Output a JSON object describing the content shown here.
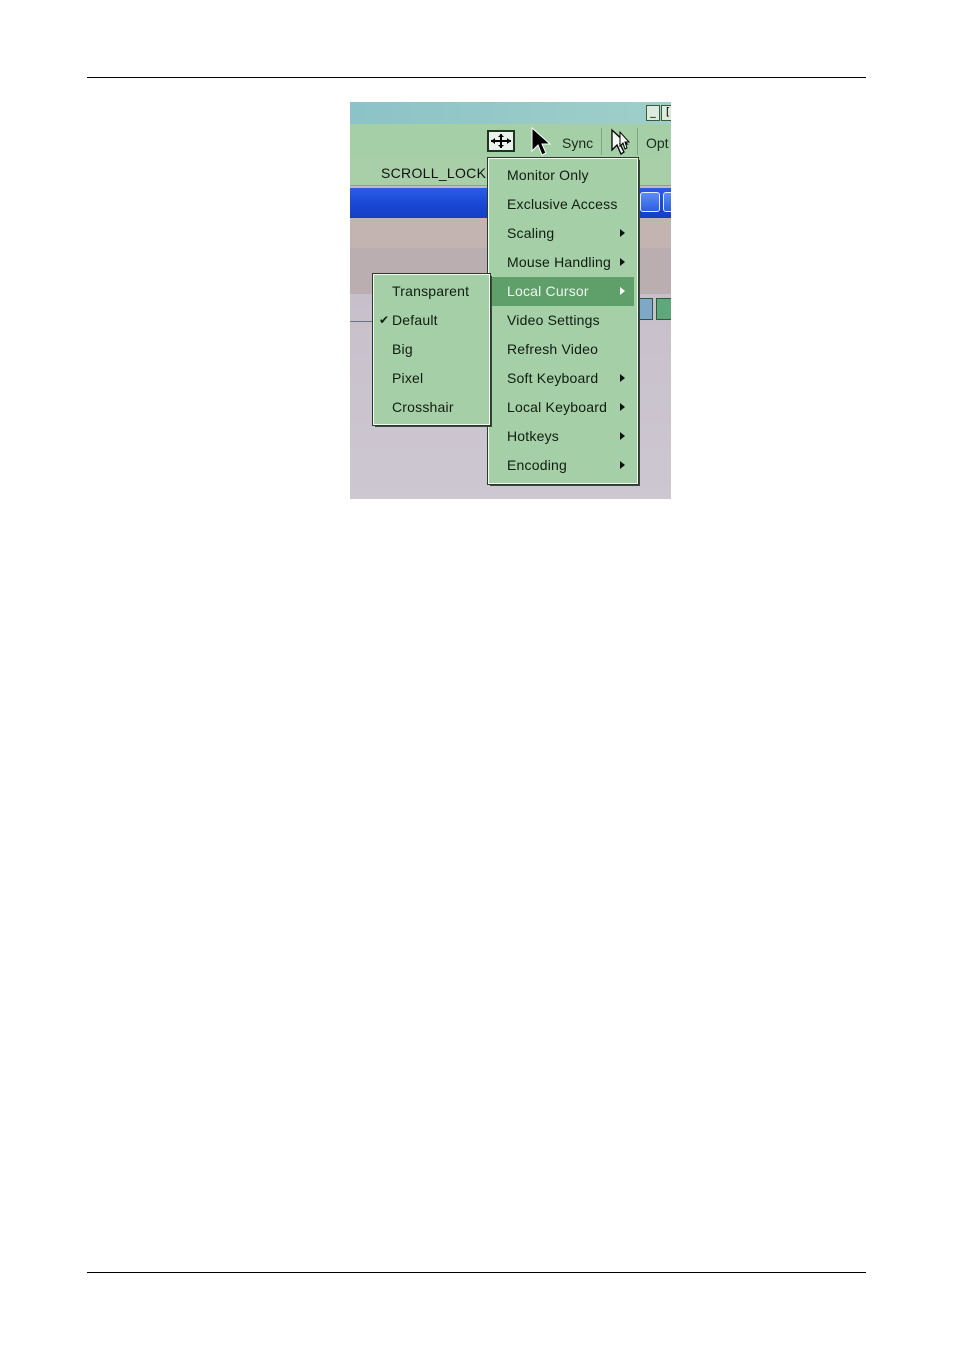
{
  "window": {
    "minimize_glyph": "_",
    "restore_glyph": "[",
    "toolbar": {
      "sync_label": "Sync",
      "options_label": "Opt",
      "icons": [
        "move-window-icon",
        "arrow-cursor-icon",
        "hollow-cursor-icon"
      ]
    },
    "status": {
      "scroll_lock": "SCROLL_LOCK"
    }
  },
  "main_menu": {
    "items": [
      {
        "label": "Monitor Only"
      },
      {
        "label": "Exclusive Access"
      },
      {
        "label": "Scaling",
        "submenu": true
      },
      {
        "label": "Mouse Handling",
        "submenu": true
      },
      {
        "label": "Local Cursor",
        "submenu": true,
        "highlighted": true
      },
      {
        "label": "Video Settings"
      },
      {
        "label": "Refresh Video"
      },
      {
        "label": "Soft Keyboard",
        "submenu": true
      },
      {
        "label": "Local Keyboard",
        "submenu": true
      },
      {
        "label": "Hotkeys",
        "submenu": true
      },
      {
        "label": "Encoding",
        "submenu": true
      }
    ]
  },
  "cursor_submenu": {
    "items": [
      {
        "label": "Transparent",
        "checked": false
      },
      {
        "label": "Default",
        "checked": true
      },
      {
        "label": "Big",
        "checked": false
      },
      {
        "label": "Pixel",
        "checked": false
      },
      {
        "label": "Crosshair",
        "checked": false
      }
    ],
    "check_glyph": "✔"
  },
  "colors": {
    "menu_bg": "#a5cfa7",
    "highlight": "#5f9f69",
    "title_blue": "#1a47d4"
  }
}
